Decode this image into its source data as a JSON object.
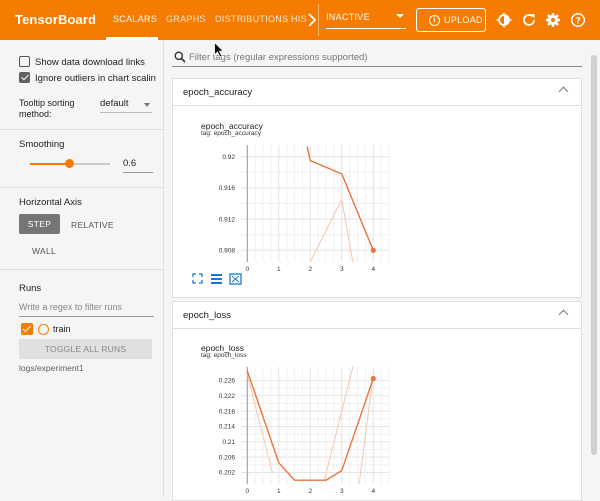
{
  "header": {
    "brand": "TensorBoard",
    "tabs": [
      {
        "label": "SCALARS",
        "active": true
      },
      {
        "label": "GRAPHS",
        "active": false
      },
      {
        "label": "DISTRIBUTIONS",
        "active": false
      },
      {
        "label": "HIS",
        "active": false
      }
    ],
    "status_select": "INACTIVE",
    "upload_label": "UPLOAD",
    "icons": [
      "chevron-right-icon",
      "theme-icon",
      "refresh-icon",
      "settings-icon",
      "help-icon"
    ]
  },
  "sidebar": {
    "show_download_links": {
      "label": "Show data download links",
      "checked": false
    },
    "ignore_outliers": {
      "label": "Ignore outliers in chart scaling",
      "checked": true
    },
    "tooltip_sorting": {
      "label_line1": "Tooltip sorting",
      "label_line2": "method:",
      "value": "default"
    },
    "smoothing": {
      "label": "Smoothing",
      "value": "0.6",
      "fraction": 0.6
    },
    "horizontal_axis": {
      "label": "Horizontal Axis",
      "options": [
        "STEP",
        "RELATIVE",
        "WALL"
      ],
      "selected": "STEP"
    },
    "runs": {
      "label": "Runs",
      "filter_placeholder": "Write a regex to filter runs",
      "items": [
        {
          "name": "train",
          "checked": true
        }
      ],
      "toggle_label": "TOGGLE ALL RUNS",
      "logdir": "logs/experiment1"
    }
  },
  "main": {
    "filter_placeholder": "Filter tags (regular expressions supported)",
    "cards": [
      {
        "title": "epoch_accuracy",
        "chart_title": "epoch_accuracy",
        "tag": "tag: epoch_accuracy"
      },
      {
        "title": "epoch_loss",
        "chart_title": "epoch_loss",
        "tag": "tag: epoch_loss"
      }
    ]
  },
  "colors": {
    "accent": "#f57c00",
    "series": "#e8743b",
    "series_raw": "#f5c6ad"
  },
  "chart_data": [
    {
      "type": "line",
      "title": "epoch_accuracy",
      "x_ticks": [
        "0",
        "1",
        "2",
        "3",
        "4"
      ],
      "y_ticks": [
        "0.92",
        "0.916",
        "0.912",
        "0.908"
      ],
      "xlim": [
        -0.2,
        4.5
      ],
      "ylim": [
        0.9065,
        0.9215
      ],
      "grid": true,
      "series": [
        {
          "smoothed": true,
          "x": [
            1.9,
            2.0,
            3.0,
            4.0
          ],
          "y": [
            0.9213,
            0.9195,
            0.9178,
            0.908
          ]
        },
        {
          "smoothed": false,
          "x": [
            2.0,
            3.0,
            3.35
          ],
          "y": [
            0.9065,
            0.9145,
            0.9065
          ]
        }
      ]
    },
    {
      "type": "line",
      "title": "epoch_loss",
      "x_ticks": [
        "0",
        "1",
        "2",
        "3",
        "4"
      ],
      "y_ticks": [
        "0.226",
        "0.222",
        "0.218",
        "0.214",
        "0.21",
        "0.206",
        "0.202"
      ],
      "xlim": [
        -0.2,
        4.5
      ],
      "ylim": [
        0.199,
        0.2295
      ],
      "grid": true,
      "series": [
        {
          "smoothed": true,
          "x": [
            0,
            1,
            1.5,
            2.5,
            3,
            4
          ],
          "y": [
            0.2285,
            0.2045,
            0.2,
            0.2,
            0.2025,
            0.2265
          ]
        },
        {
          "smoothed": false,
          "x": [
            0,
            0.8
          ],
          "y": [
            0.2275,
            0.202
          ]
        },
        {
          "smoothed": false,
          "x": [
            2.45,
            3.35
          ],
          "y": [
            0.2,
            0.2295
          ]
        },
        {
          "smoothed": false,
          "x": [
            3.55,
            4.0
          ],
          "y": [
            0.199,
            0.2275
          ]
        }
      ]
    }
  ]
}
